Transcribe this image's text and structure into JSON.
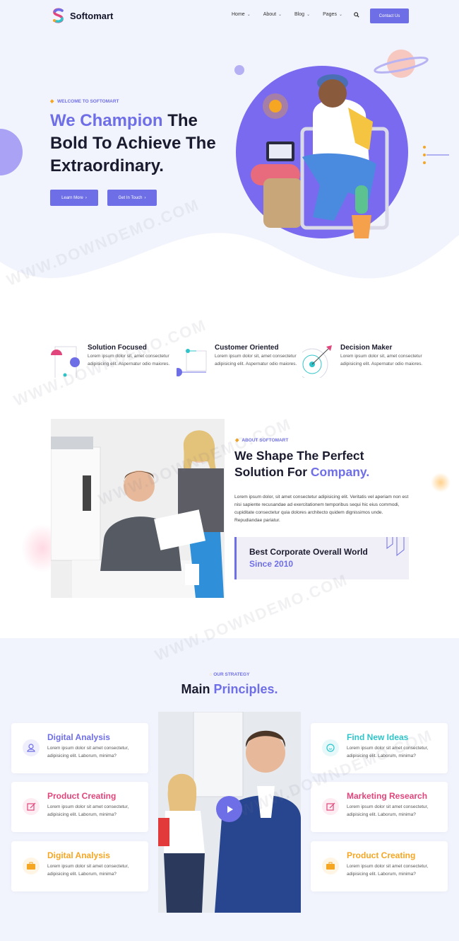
{
  "brand": {
    "name": "Softomart"
  },
  "nav": {
    "items": [
      {
        "label": "Home"
      },
      {
        "label": "About"
      },
      {
        "label": "Blog"
      },
      {
        "label": "Pages"
      }
    ],
    "contact_label": "Contact Us"
  },
  "hero": {
    "eyebrow": "WELCOME TO SOFTOMART",
    "title_accent": "We Champion",
    "title_rest": " The Bold To Achieve The Extraordinary.",
    "btn_learn": "Learn More",
    "btn_touch": "Get In Touch"
  },
  "features": [
    {
      "title": "Solution Focused",
      "text": "Lorem ipsum dolor sit, amet consectetur adipisicing elit. Aspernatur odio maiores."
    },
    {
      "title": "Customer Oriented",
      "text": "Lorem ipsum dolor sit, amet consectetur adipisicing elit. Aspernatur odio maiores."
    },
    {
      "title": "Decision Maker",
      "text": "Lorem ipsum dolor sit, amet consectetur adipisicing elit. Aspernatur odio maiores."
    }
  ],
  "about": {
    "eyebrow": "ABOUT SOFTOMART",
    "title_line1": "We Shape The Perfect",
    "title_line2a": "Solution For ",
    "title_line2b": "Company.",
    "text": "Lorem ipsum dolor, sit amet consectetur adipisicing elit. Veritatis vel aperiam non est nisi sapiente recusandae ad exercitationem temporibus sequi hic eius commodi, cupiditate consectetur quia dolores architecto quidem dignissimos unde. Repudiandae pariatur.",
    "quote_line1": "Best Corporate Overall World",
    "quote_line2": "Since 2010"
  },
  "principles": {
    "eyebrow": "OUR STRATEGY",
    "title_a": "Main ",
    "title_b": "Principles.",
    "cards": [
      {
        "title": "Digital Analysis",
        "text": "Lorem ipsum dolor sit amet consectetur, adipisicing elit. Laborum, minima?",
        "color": "#6e6ee6",
        "icon": "user-icon"
      },
      {
        "title": "Product Creating",
        "text": "Lorem ipsum dolor sit amet consectetur, adipisicing elit. Laborum, minima?",
        "color": "#e0457b",
        "icon": "edit-icon"
      },
      {
        "title": "Digital Analysis",
        "text": "Lorem ipsum dolor sit amet consectetur, adipisicing elit. Laborum, minima?",
        "color": "#f5a623",
        "icon": "briefcase-icon"
      },
      {
        "title": "Find New Ideas",
        "text": "Lorem ipsum dolor sit amet consectetur, adipisicing elit. Laborum, minima?",
        "color": "#2ec4c9",
        "icon": "smile-icon"
      },
      {
        "title": "Marketing Research",
        "text": "Lorem ipsum dolor sit amet consectetur, adipisicing elit. Laborum, minima?",
        "color": "#e0457b",
        "icon": "edit-icon"
      },
      {
        "title": "Product Creating",
        "text": "Lorem ipsum dolor sit amet consectetur, adipisicing elit. Laborum, minima?",
        "color": "#f5a623",
        "icon": "briefcase-icon"
      }
    ]
  },
  "watermark": "WWW.DOWNDEMO.COM",
  "colors": {
    "accent": "#6e6ee6",
    "pink": "#e0457b",
    "orange": "#f5a623",
    "teal": "#2ec4c9"
  }
}
